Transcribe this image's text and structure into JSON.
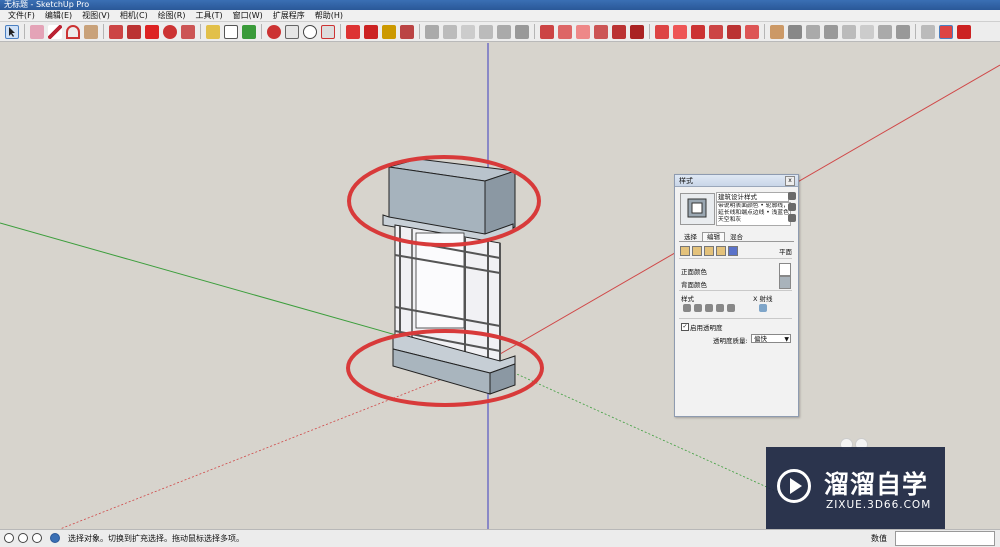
{
  "window": {
    "title": "无标题 - SketchUp Pro"
  },
  "menu": [
    "文件(F)",
    "编辑(E)",
    "视图(V)",
    "相机(C)",
    "绘图(R)",
    "工具(T)",
    "窗口(W)",
    "扩展程序",
    "帮助(H)"
  ],
  "toolbar": {
    "icons": [
      "select-icon",
      "eraser-icon",
      "pencil-icon",
      "arc-icon",
      "rectangle-icon",
      "pushpull-icon",
      "followme-icon",
      "move-icon",
      "rotate-icon",
      "scale-icon",
      "tape-icon",
      "text-icon",
      "paint-icon",
      "orbit-icon",
      "pan-icon",
      "zoom-icon",
      "zoom-extents-icon",
      "warehouse-icon",
      "extension-warehouse-icon",
      "sandbox-icon",
      "layout-icon"
    ]
  },
  "styles_panel": {
    "title": "样式",
    "close": "x",
    "style_name": "建筑设计样式",
    "style_description": "带说明表面颜色 • 轮廓线，延长线和端点边线 • 浅蓝色天空和灰",
    "tabs": [
      "选择",
      "编辑",
      "混合"
    ],
    "active_tab": "编辑",
    "section_plane": "平面",
    "front_color_label": "正面颜色",
    "back_color_label": "背面颜色",
    "front_color": "#ffffff",
    "back_color": "#a9b3bb",
    "style_label": "样式",
    "xray_label": "X 射线",
    "enable_transparency_label": "启用透明度",
    "enable_transparency_checked": "✓",
    "transparency_quality_label": "透明度质量:",
    "transparency_quality_value": "偏快",
    "dropdown_arrow": "▼"
  },
  "watermark": {
    "title": "溜溜自学",
    "url": "ZIXUE.3D66.COM"
  },
  "status": {
    "message": "选择对象。切换到扩充选择。拖动鼠标选择多项。",
    "measure_label": "数值",
    "measure_value": ""
  },
  "colors": {
    "axis_red": "#d04848",
    "axis_green": "#3c9e3c",
    "axis_blue": "#3b3bbf",
    "highlight": "#d83a3a"
  }
}
